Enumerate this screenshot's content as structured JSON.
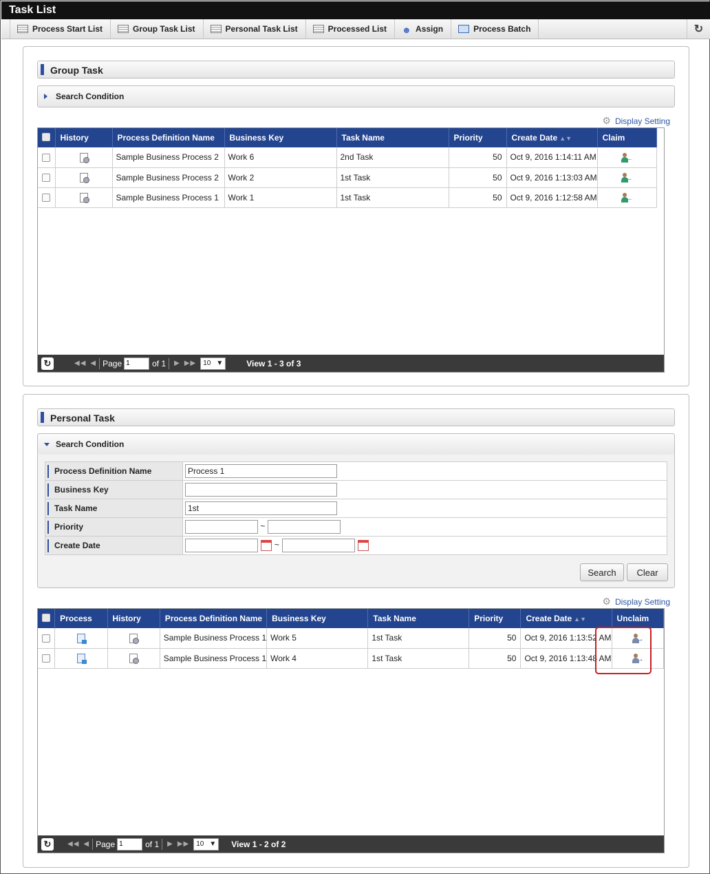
{
  "app": {
    "title": "Task List"
  },
  "tabs": [
    {
      "label": "Process Start List",
      "icon": "list-icon"
    },
    {
      "label": "Group Task List",
      "icon": "list-icon"
    },
    {
      "label": "Personal Task List",
      "icon": "list-icon"
    },
    {
      "label": "Processed List",
      "icon": "list-icon"
    },
    {
      "label": "Assign",
      "icon": "assign-person-icon"
    },
    {
      "label": "Process Batch",
      "icon": "batch-icon"
    }
  ],
  "group": {
    "title": "Group Task",
    "search_label": "Search Condition",
    "display_setting": "Display Setting",
    "columns": [
      "History",
      "Process Definition Name",
      "Business Key",
      "Task Name",
      "Priority",
      "Create Date",
      "Claim"
    ],
    "rows": [
      {
        "process": "Sample Business Process 2",
        "key": "Work 6",
        "task": "2nd Task",
        "priority": "50",
        "date": "Oct 9, 2016 1:14:11 AM"
      },
      {
        "process": "Sample Business Process 2",
        "key": "Work 2",
        "task": "1st Task",
        "priority": "50",
        "date": "Oct 9, 2016 1:13:03 AM"
      },
      {
        "process": "Sample Business Process 1",
        "key": "Work 1",
        "task": "1st Task",
        "priority": "50",
        "date": "Oct 9, 2016 1:12:58 AM"
      }
    ],
    "pager": {
      "page_label": "Page",
      "page": "1",
      "of": "of 1",
      "size": "10",
      "view": "View 1 - 3 of 3"
    }
  },
  "personal": {
    "title": "Personal Task",
    "search_label": "Search Condition",
    "display_setting": "Display Setting",
    "form": {
      "process_label": "Process Definition Name",
      "process_value": "Process 1",
      "key_label": "Business Key",
      "key_value": "",
      "task_label": "Task Name",
      "task_value": "1st",
      "priority_label": "Priority",
      "priority_from": "",
      "priority_to": "",
      "date_label": "Create Date",
      "date_from": "",
      "date_to": "",
      "range_sep": "~"
    },
    "search_button": "Search",
    "clear_button": "Clear",
    "columns": [
      "Process",
      "History",
      "Process Definition Name",
      "Business Key",
      "Task Name",
      "Priority",
      "Create Date",
      "Unclaim"
    ],
    "rows": [
      {
        "process": "Sample Business Process 1",
        "key": "Work 5",
        "task": "1st Task",
        "priority": "50",
        "date": "Oct 9, 2016 1:13:52 AM"
      },
      {
        "process": "Sample Business Process 1",
        "key": "Work 4",
        "task": "1st Task",
        "priority": "50",
        "date": "Oct 9, 2016 1:13:48 AM"
      }
    ],
    "pager": {
      "page_label": "Page",
      "page": "1",
      "of": "of 1",
      "size": "10",
      "view": "View 1 - 2 of 2"
    }
  }
}
